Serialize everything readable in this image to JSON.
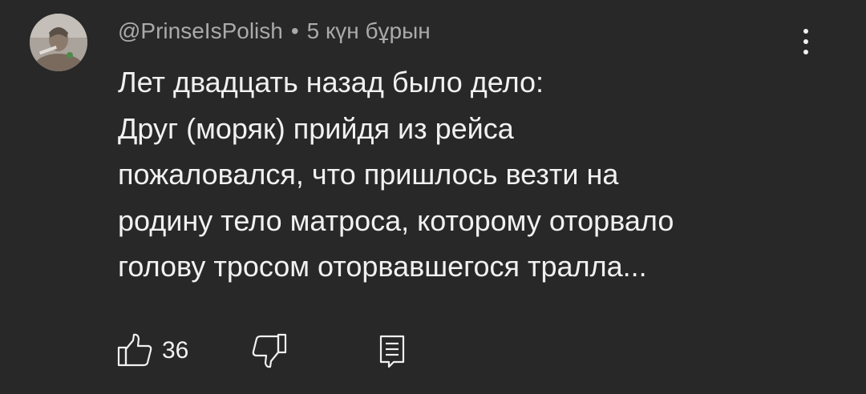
{
  "comment": {
    "author": "@PrinseIsPolish",
    "separator": "•",
    "time": "5 күн бұрын",
    "lines": [
      "Лет двадцать назад было дело:",
      "Друг (моряк) прийдя из рейса",
      "пожаловался, что пришлось везти на",
      "родину тело матроса, которому оторвало",
      "голову тросом оторвавшегося тралла..."
    ],
    "like_count": "36"
  },
  "icons": {
    "avatar": "avatar-photo",
    "more": "more-vertical-icon",
    "like": "thumb-up-icon",
    "dislike": "thumb-down-icon",
    "reply": "reply-comment-icon"
  },
  "colors": {
    "background": "#282828",
    "text": "#f1f1f1",
    "meta": "#aaaaaa"
  }
}
